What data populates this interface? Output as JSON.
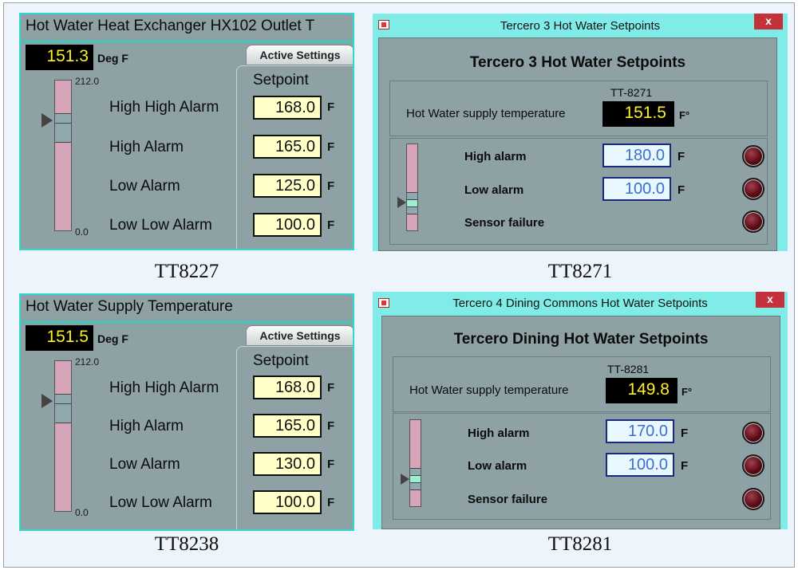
{
  "panels": {
    "tt8227": {
      "title": "Hot Water Heat Exchanger HX102 Outlet T",
      "pv": "151.3",
      "unit": "Deg F",
      "tab": "Active Settings",
      "setpoint_header": "Setpoint",
      "scale_max": "212.0",
      "scale_min": "0.0",
      "rows": [
        {
          "label": "High High Alarm",
          "value": "168.0",
          "unit": "F"
        },
        {
          "label": "High Alarm",
          "value": "165.0",
          "unit": "F"
        },
        {
          "label": "Low Alarm",
          "value": "125.0",
          "unit": "F"
        },
        {
          "label": "Low Low Alarm",
          "value": "100.0",
          "unit": "F"
        }
      ],
      "caption": "TT8227"
    },
    "tt8238": {
      "title": "Hot Water Supply Temperature",
      "pv": "151.5",
      "unit": "Deg F",
      "tab": "Active Settings",
      "setpoint_header": "Setpoint",
      "scale_max": "212.0",
      "scale_min": "0.0",
      "rows": [
        {
          "label": "High High Alarm",
          "value": "168.0",
          "unit": "F"
        },
        {
          "label": "High Alarm",
          "value": "165.0",
          "unit": "F"
        },
        {
          "label": "Low Alarm",
          "value": "130.0",
          "unit": "F"
        },
        {
          "label": "Low Low Alarm",
          "value": "100.0",
          "unit": "F"
        }
      ],
      "caption": "TT8238"
    },
    "tt8271": {
      "window_title": "Tercero 3 Hot Water Setpoints",
      "close": "x",
      "body_title": "Tercero 3 Hot Water Setpoints",
      "tag": "TT-8271",
      "supply_label": "Hot Water supply temperature",
      "pv": "151.5",
      "pv_unit": "F°",
      "alarms": [
        {
          "label": "High alarm",
          "value": "180.0",
          "unit": "F"
        },
        {
          "label": "Low alarm",
          "value": "100.0",
          "unit": "F"
        }
      ],
      "sensor_failure": "Sensor failure",
      "caption": "TT8271"
    },
    "tt8281": {
      "window_title": "Tercero 4 Dining Commons Hot Water Setpoints",
      "close": "x",
      "body_title": "Tercero Dining Hot Water Setpoints",
      "tag": "TT-8281",
      "supply_label": "Hot Water supply temperature",
      "pv": "149.8",
      "pv_unit": "F°",
      "alarms": [
        {
          "label": "High alarm",
          "value": "170.0",
          "unit": "F"
        },
        {
          "label": "Low alarm",
          "value": "100.0",
          "unit": "F"
        }
      ],
      "sensor_failure": "Sensor failure",
      "caption": "TT8281"
    }
  }
}
